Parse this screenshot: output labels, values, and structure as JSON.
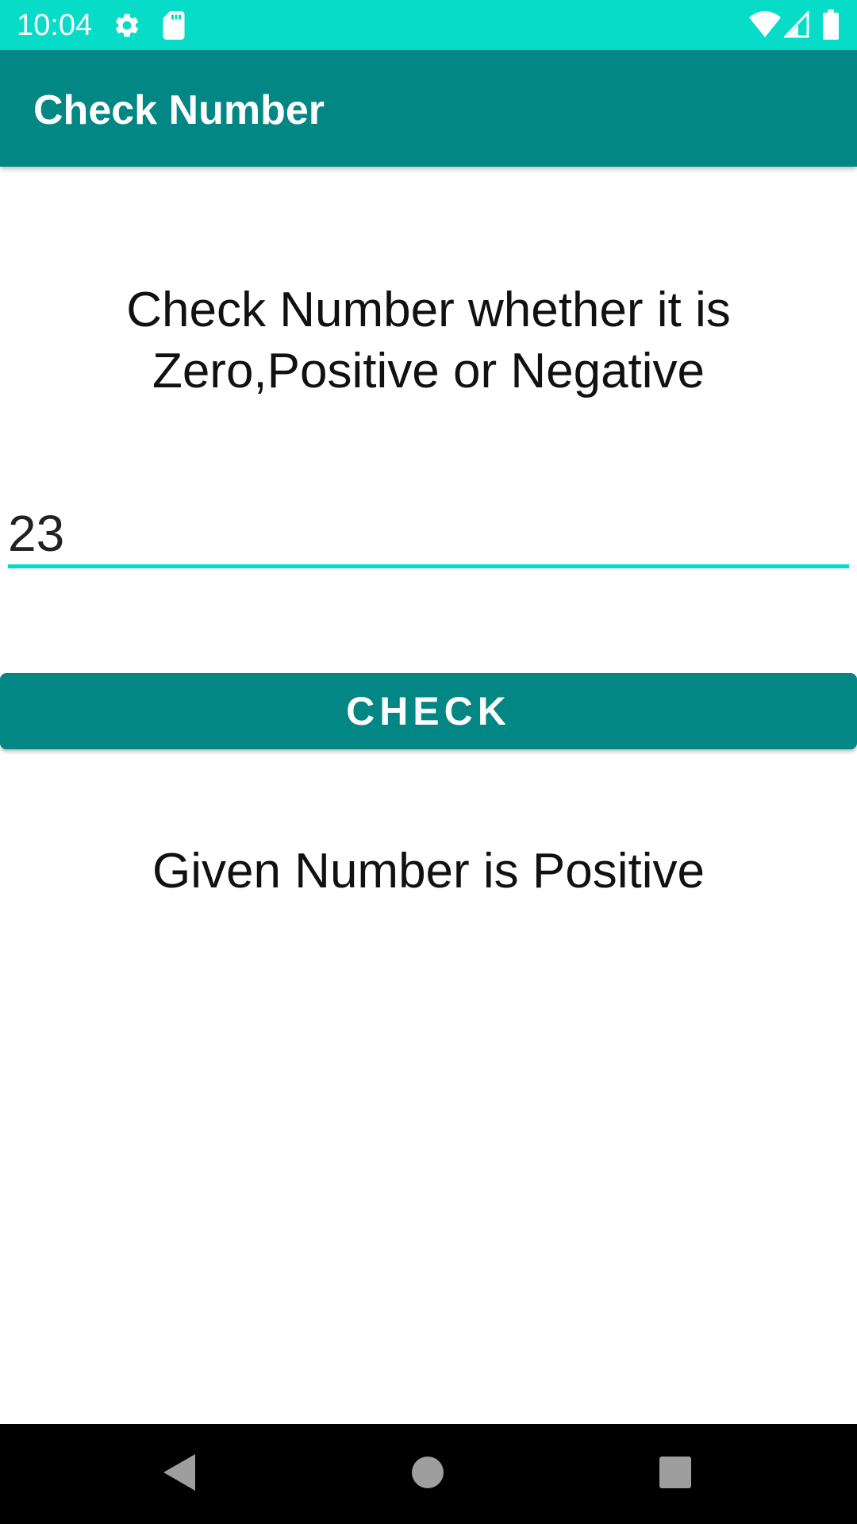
{
  "status_bar": {
    "time": "10:04",
    "background": "#07DCC8",
    "icons": [
      "settings-icon",
      "sd-card-icon",
      "wifi-icon",
      "signal-icon",
      "battery-icon"
    ]
  },
  "app_bar": {
    "title": "Check Number",
    "background": "#028784"
  },
  "main": {
    "heading": "Check Number whether it is Zero,Positive or Negative",
    "number_input": {
      "value": "23",
      "underline_color": "#07DCC8"
    },
    "check_button": {
      "label": "CHECK",
      "background": "#028784"
    },
    "result_text": "Given Number is Positive"
  },
  "nav_bar": {
    "buttons": [
      "back-icon",
      "home-icon",
      "recents-icon"
    ]
  }
}
